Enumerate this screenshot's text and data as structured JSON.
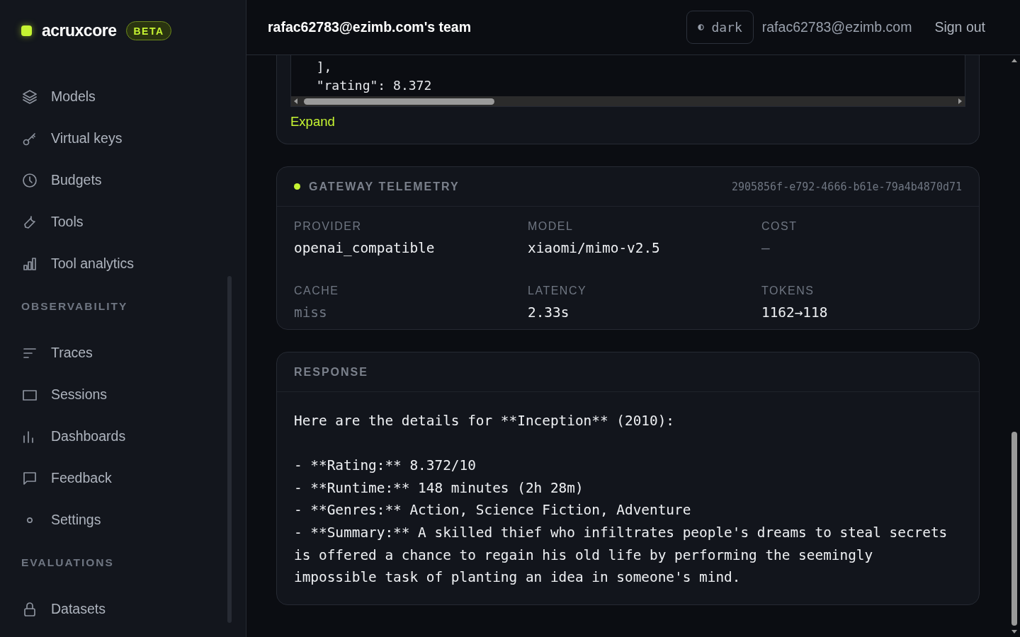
{
  "brand": {
    "name": "acruxcore",
    "badge": "BETA"
  },
  "sidebar": {
    "sections": [
      {
        "items": [
          {
            "label": "Models",
            "selected": false
          },
          {
            "label": "Virtual keys",
            "selected": false
          },
          {
            "label": "Budgets",
            "selected": false
          },
          {
            "label": "Tools",
            "selected": false
          },
          {
            "label": "Tool analytics",
            "selected": false
          }
        ]
      },
      {
        "title": "OBSERVABILITY",
        "items": [
          {
            "label": "Traces",
            "selected": false
          },
          {
            "label": "Sessions",
            "selected": false
          },
          {
            "label": "Dashboards",
            "selected": false
          },
          {
            "label": "Feedback",
            "selected": false
          },
          {
            "label": "Settings",
            "selected": false
          }
        ]
      },
      {
        "title": "EVALUATIONS",
        "items": [
          {
            "label": "Datasets",
            "selected": false
          }
        ]
      }
    ]
  },
  "header": {
    "team": "rafac62783@ezimb.com's team",
    "theme_toggle": {
      "label": "dark"
    },
    "user": "rafac62783@ezimb.com",
    "sign_out": "Sign out"
  },
  "code_card": {
    "lines": [
      "  ],",
      "  \"rating\": 8.372"
    ],
    "expand": "Expand"
  },
  "telemetry": {
    "title": "GATEWAY TELEMETRY",
    "id": "2905856f-e792-4666-b61e-79a4b4870d71",
    "fields": [
      {
        "label": "PROVIDER",
        "value": "openai_compatible",
        "muted": false
      },
      {
        "label": "MODEL",
        "value": "xiaomi/mimo-v2.5",
        "muted": false
      },
      {
        "label": "COST",
        "value": "—",
        "muted": true
      },
      {
        "label": "CACHE",
        "value": "miss",
        "muted": true
      },
      {
        "label": "LATENCY",
        "value": "2.33s",
        "muted": false
      },
      {
        "label": "TOKENS",
        "value": "1162→118",
        "muted": false
      }
    ]
  },
  "response": {
    "title": "RESPONSE",
    "text": "Here are the details for **Inception** (2010):\n\n- **Rating:** 8.372/10\n- **Runtime:** 148 minutes (2h 28m)\n- **Genres:** Action, Science Fiction, Adventure\n- **Summary:** A skilled thief who infiltrates people's dreams to steal secrets is offered a chance to regain his old life by performing the seemingly impossible task of planting an idea in someone's mind."
  }
}
